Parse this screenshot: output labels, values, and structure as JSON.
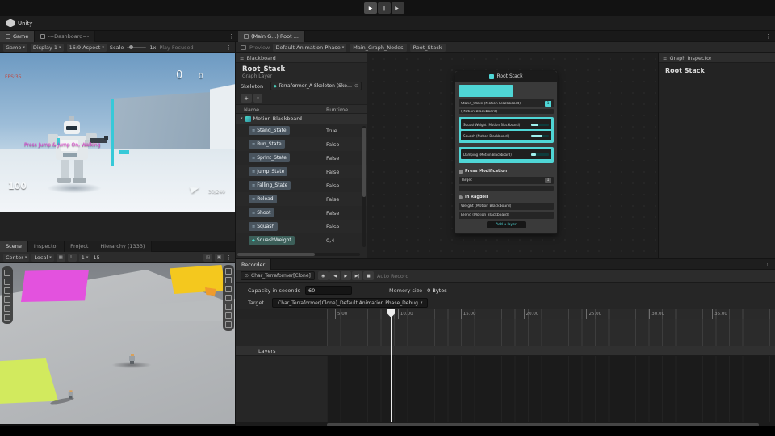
{
  "icons": {
    "menu": "⋮",
    "caret": "▾",
    "foldout": "▾",
    "plus": "+",
    "picker": "⊙",
    "rows": "≡",
    "diamond": "◆",
    "play": "▶",
    "pause": "∥",
    "step": "▶∣"
  },
  "titlebar": {
    "app": "Unity"
  },
  "game_panel": {
    "tabs": [
      {
        "label": "Game",
        "state": "active"
      },
      {
        "label": "-=Dashboard=-"
      }
    ],
    "toolbar": {
      "game": "Game",
      "display": "Display 1",
      "aspect": "16:9 Aspect",
      "scale_label": "Scale",
      "scale_value": "1x",
      "play_focused": "Play Focused"
    },
    "hud": {
      "fps": "FPS:35",
      "counter_a": "0",
      "counter_b": "0",
      "status_message": "Press Jump & Jump On, Walking",
      "health": "100",
      "ammo": "30/240"
    }
  },
  "scene_panel": {
    "tabs": [
      {
        "label": "Scene",
        "state": "active"
      },
      {
        "label": "Inspector"
      },
      {
        "label": "Project"
      },
      {
        "label": "Hierarchy (1333)"
      }
    ],
    "toolbar": {
      "pivot": "Center",
      "orientation": "Local",
      "grid_value": "1",
      "snap_value": "15"
    }
  },
  "graph_window": {
    "tab": "(Main G...) Root ...",
    "breadcrumbs": {
      "preview": "Preview",
      "phase": "Default Animation Phase",
      "nodes": "Main_Graph_Nodes",
      "stack": "Root_Stack"
    }
  },
  "blackboard": {
    "header": "Blackboard",
    "title": "Root_Stack",
    "subtitle": "Graph Layer",
    "skeleton_label": "Skeleton",
    "skeleton_value": "Terraformer_A-Skeleton (Skeleton)",
    "columns": {
      "name": "Name",
      "runtime": "Runtime"
    },
    "group": "Motion Blackboard",
    "rows": [
      {
        "name": "Stand_State",
        "value": "True",
        "kind": "state",
        "ic": "≡"
      },
      {
        "name": "Run_State",
        "value": "False",
        "kind": "state",
        "ic": "≡"
      },
      {
        "name": "Sprint_State",
        "value": "False",
        "kind": "state",
        "ic": "≡"
      },
      {
        "name": "Jump_State",
        "value": "False",
        "kind": "state",
        "ic": "≡"
      },
      {
        "name": "Falling_State",
        "value": "False",
        "kind": "state",
        "ic": "≡"
      },
      {
        "name": "Reload",
        "value": "False",
        "kind": "state",
        "ic": "≡"
      },
      {
        "name": "Shoot",
        "value": "False",
        "kind": "state",
        "ic": "≡"
      },
      {
        "name": "Squash",
        "value": "False",
        "kind": "state",
        "ic": "≡"
      },
      {
        "name": "SquashWeight",
        "value": "0,4",
        "kind": "float",
        "ic": "◆"
      }
    ]
  },
  "graph_node": {
    "title": "Root Stack",
    "row1_label": "Stand_State (Motion Blackboard)",
    "row1_value": "1",
    "row2_label": "(Motion Blackboard)",
    "block1_row1": "SquashWeight (Motion Blackboard)",
    "block1_row2": "Squash (Motion Blackboard)",
    "block2_row1": "Damping (Motion Blackboard)",
    "section1": "Press Modification",
    "section1_row_label": "Target",
    "section1_row_value": "1",
    "section2": "In Ragdoll",
    "section2_row1": "Weight (Motion Blackboard)",
    "section2_row2": "Blend (Motion Blackboard)",
    "footer_button": "Add a layer"
  },
  "graph_inspector": {
    "tab": "Graph Inspector",
    "title": "Root Stack"
  },
  "recorder": {
    "tab": "Recorder",
    "source": "Char_Terraformer[Clone]",
    "transport": [
      {
        "g": "◉"
      },
      {
        "g": "|◀"
      },
      {
        "g": "▶"
      },
      {
        "g": "▶|"
      },
      {
        "g": "■"
      }
    ],
    "auto_record": "Auto Record",
    "capacity_label": "Capacity in seconds",
    "capacity_value": "60",
    "memory_label": "Memory size",
    "memory_value": "0 Bytes",
    "target_label": "Target",
    "target_value": "Char_Terraformer(Clone)_Default Animation Phase_Debug",
    "layers_label": "Layers",
    "ruler": [
      "5.00",
      "10.00",
      "15.00",
      "20.00",
      "25.00",
      "30.00",
      "35.00"
    ]
  }
}
